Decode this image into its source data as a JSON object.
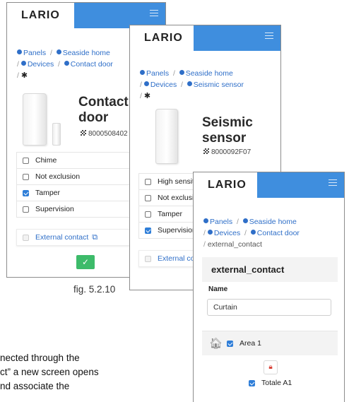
{
  "brand": "LARIO",
  "screen1": {
    "breadcrumb": {
      "panels": "Panels",
      "home": "Seaside home",
      "devices": "Devices",
      "device": "Contact door"
    },
    "title_line1": "Contact",
    "title_line2": "door",
    "serial": "8000508402",
    "options": [
      {
        "label": "Chime",
        "checked": false
      },
      {
        "label": "Not exclusion",
        "checked": false
      },
      {
        "label": "Tamper",
        "checked": true
      },
      {
        "label": "Supervision",
        "checked": false
      }
    ],
    "external_label": "External contact",
    "ok_symbol": "✓"
  },
  "screen2": {
    "breadcrumb": {
      "panels": "Panels",
      "home": "Seaside home",
      "devices": "Devices",
      "device": "Seismic sensor"
    },
    "title_line1": "Seismic",
    "title_line2": "sensor",
    "serial": "8000092F07",
    "options": [
      {
        "label": "High sensitivity",
        "checked": false
      },
      {
        "label": "Not exclusion",
        "checked": false
      },
      {
        "label": "Tamper",
        "checked": false
      },
      {
        "label": "Supervision",
        "checked": true
      }
    ],
    "external_label": "External contact"
  },
  "screen3": {
    "breadcrumb": {
      "panels": "Panels",
      "home": "Seaside home",
      "devices": "Devices",
      "device": "Contact door",
      "current": "external_contact"
    },
    "card_title": "external_contact",
    "name_label": "Name",
    "name_value": "Curtain",
    "area_label": "Area 1",
    "totale_label": "Totale A1"
  },
  "caption": "fig. 5.2.10",
  "body_lines": [
    "nected through the",
    "ct” a new screen opens",
    "nd associate the"
  ],
  "colors": {
    "header_blue": "#3f8ede",
    "link_blue": "#2f6fc8",
    "ok_green": "#3dbb6a"
  }
}
